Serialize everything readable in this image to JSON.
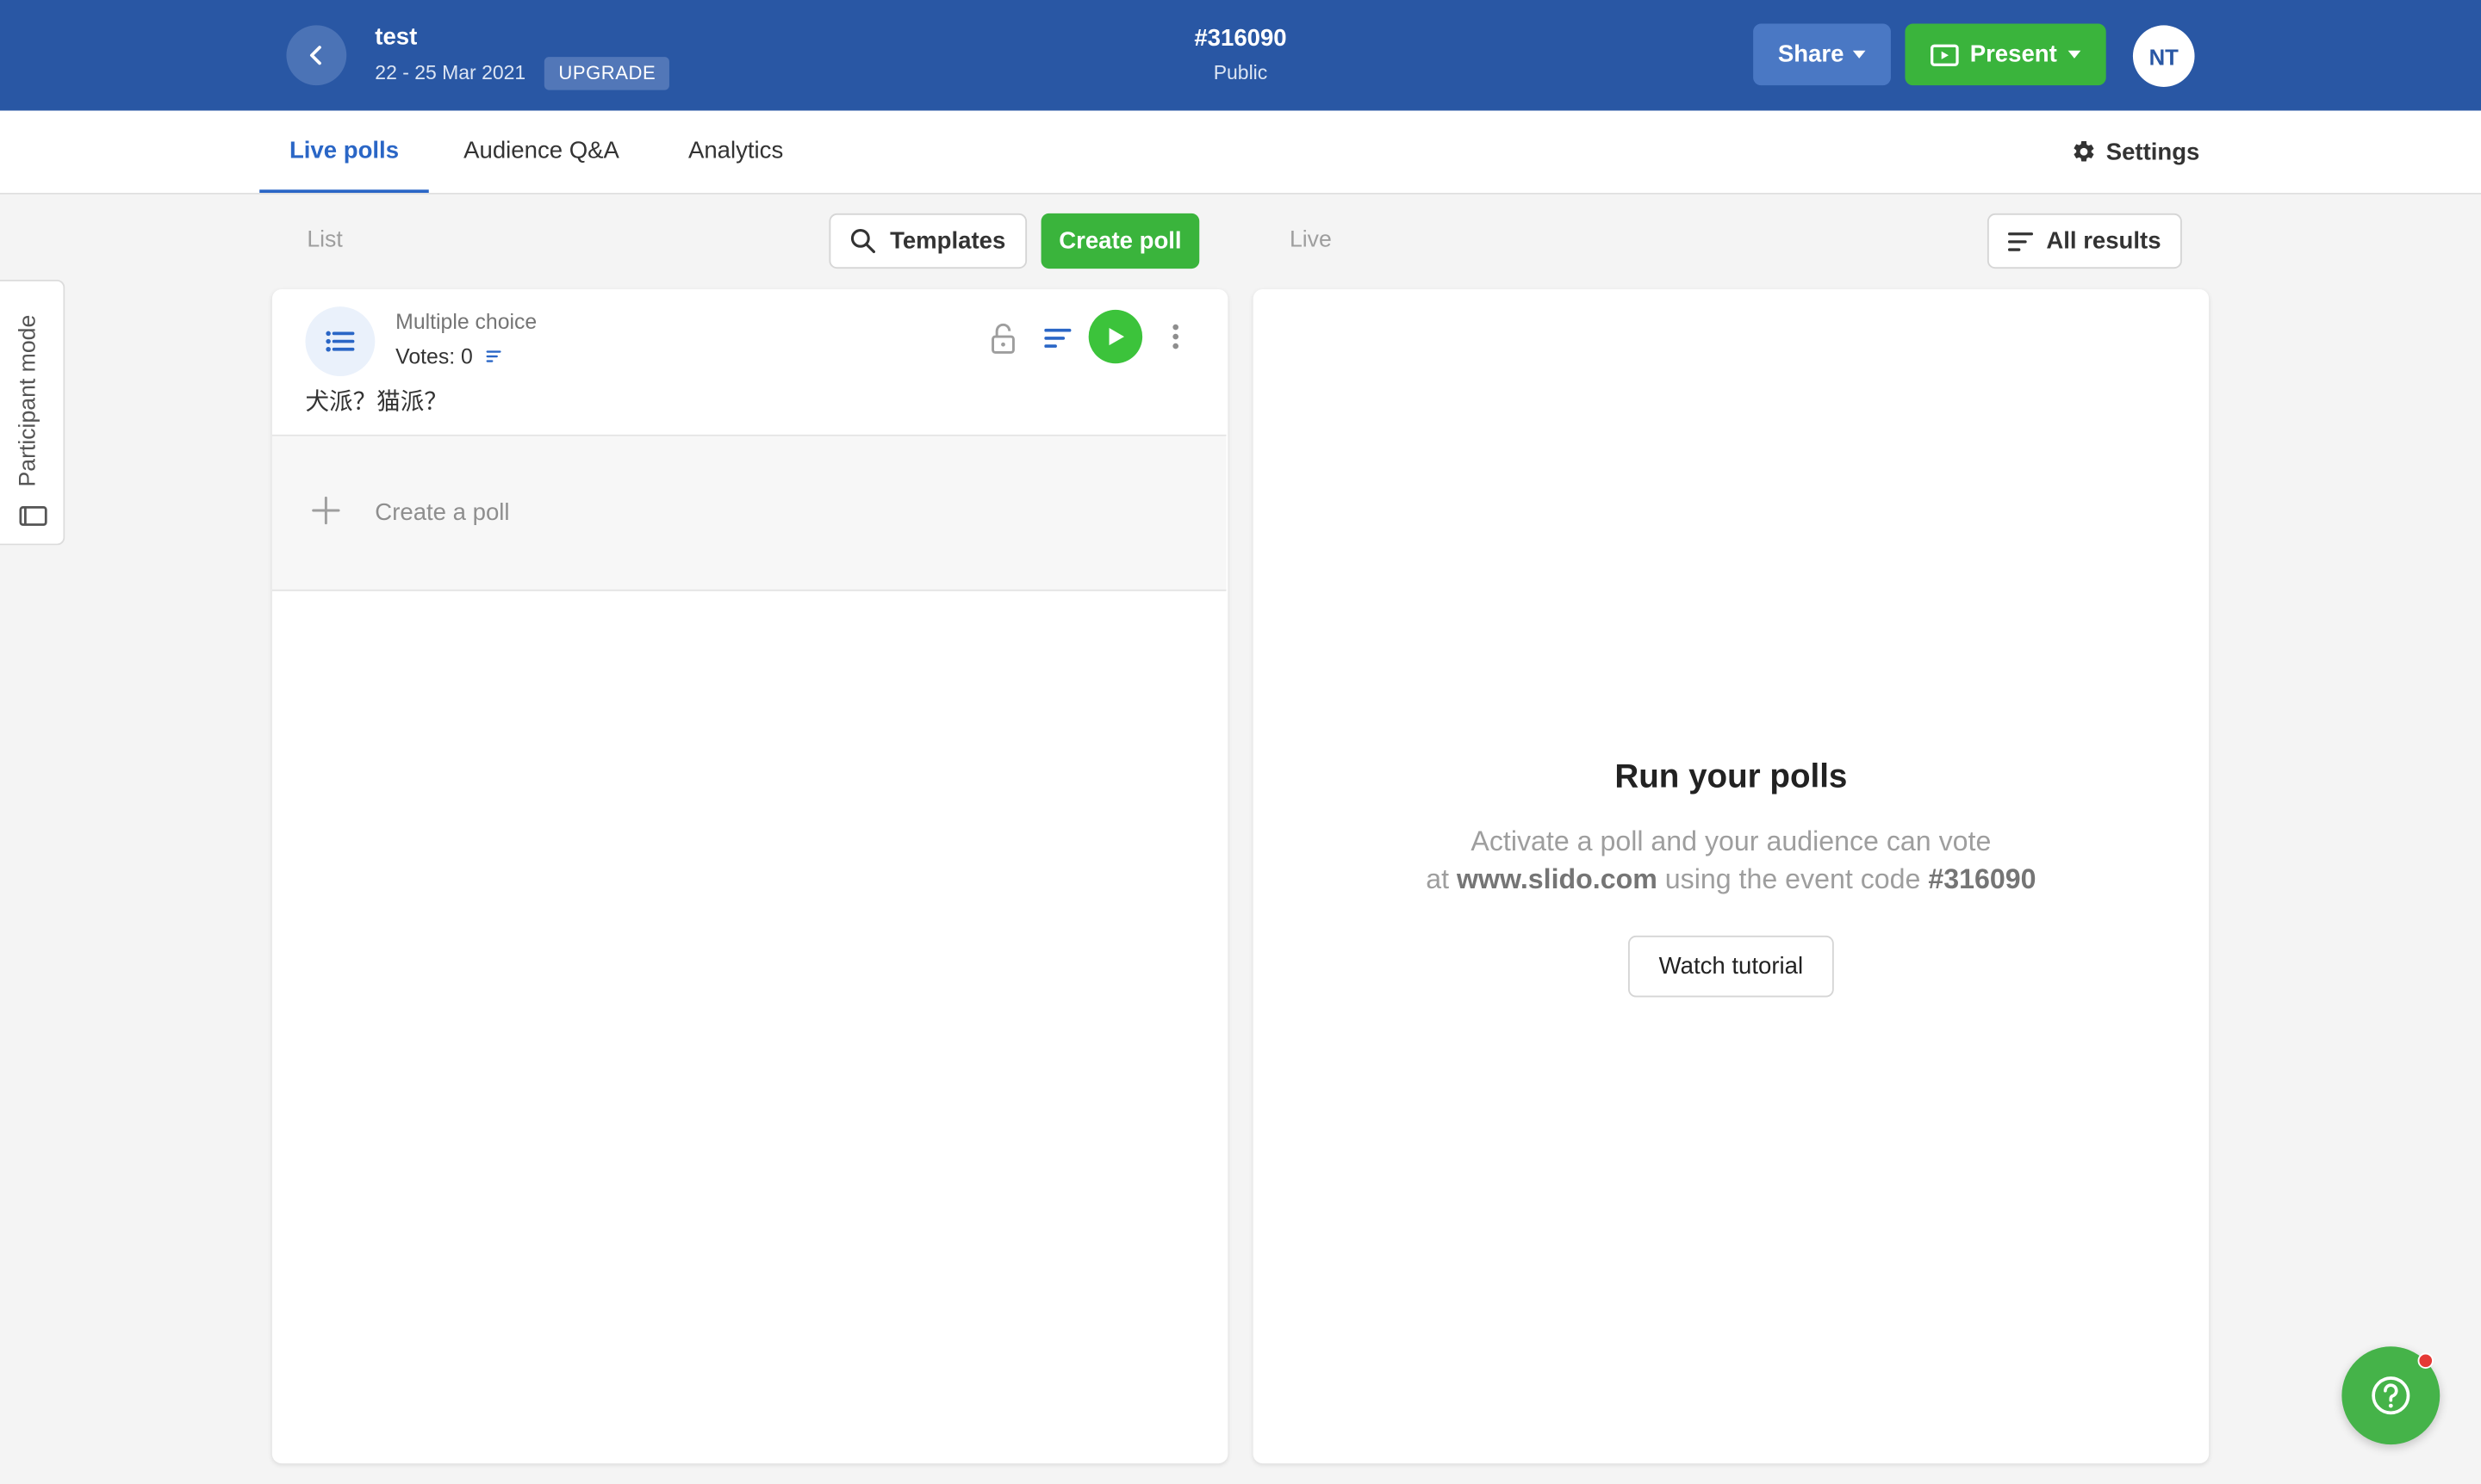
{
  "header": {
    "event_name": "test",
    "event_dates": "22 - 25 Mar 2021",
    "upgrade_label": "UPGRADE",
    "event_code": "#316090",
    "privacy": "Public",
    "share_label": "Share",
    "present_label": "Present",
    "avatar_initials": "NT",
    "brand_color": "#2957a4"
  },
  "tabs": [
    {
      "label": "Live polls",
      "active": true
    },
    {
      "label": "Audience Q&A",
      "active": false
    },
    {
      "label": "Analytics",
      "active": false
    }
  ],
  "settings_label": "Settings",
  "list_section": {
    "label": "List",
    "templates_label": "Templates",
    "create_poll_label": "Create poll",
    "polls": [
      {
        "type": "Multiple choice",
        "votes": "Votes: 0",
        "question": "犬派？猫派？"
      }
    ],
    "create_row_label": "Create a poll"
  },
  "live_section": {
    "label": "Live",
    "all_results_label": "All results",
    "empty_title": "Run your polls",
    "empty_line1": "Activate a poll and your audience can vote",
    "empty_line2_prefix": "at",
    "empty_site": "www.slido.com",
    "empty_line2_mid": "using the event code",
    "empty_code": "#316090",
    "watch_label": "Watch tutorial"
  },
  "participant_mode_label": "Participant mode",
  "accent_green": "#3ab43c"
}
